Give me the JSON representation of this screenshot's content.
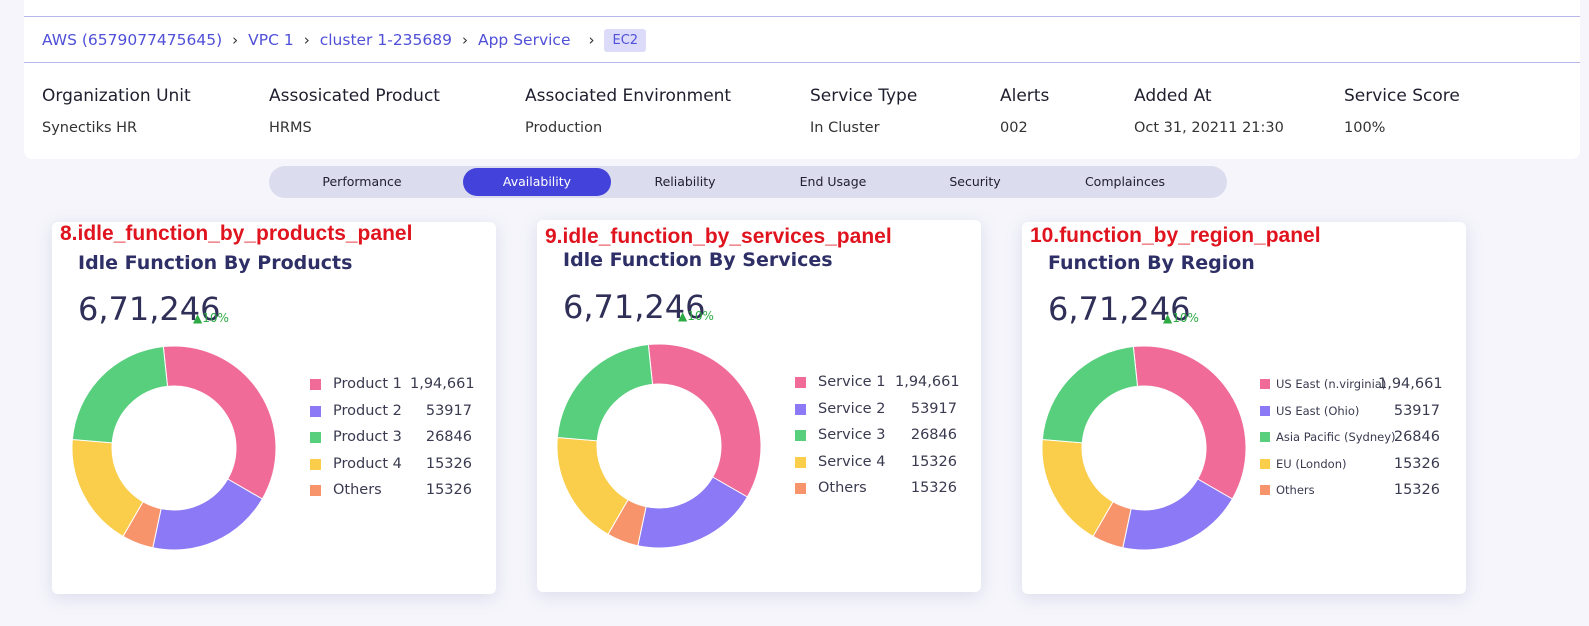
{
  "breadcrumb": {
    "items": [
      "AWS (6579077475645)",
      "VPC 1",
      "cluster 1-235689",
      "App Service"
    ],
    "current": "EC2"
  },
  "info": [
    {
      "label": "Organization Unit",
      "value": "Synectiks HR"
    },
    {
      "label": "Assosicated Product",
      "value": "HRMS"
    },
    {
      "label": "Associated Environment",
      "value": "Production"
    },
    {
      "label": "Service Type",
      "value": "In Cluster"
    },
    {
      "label": "Alerts",
      "value": "002"
    },
    {
      "label": "Added At",
      "value": "Oct 31, 20211 21:30"
    },
    {
      "label": "Service Score",
      "value": "100%"
    }
  ],
  "tabs": [
    "Performance",
    "Availability",
    "Reliability",
    "End Usage",
    "Security",
    "Complainces"
  ],
  "active_tab": "Availability",
  "colors": {
    "accent": "#4343dc",
    "pink": "#f06b98",
    "purple": "#8b79f5",
    "orange": "#f7946b",
    "yellow": "#facd4b",
    "green": "#57cf7c",
    "annotation": "#e0141e",
    "up": "#2eaa44"
  },
  "panels": [
    {
      "tag": "8.idle_function_by_products_panel",
      "title": "Idle Function By Products",
      "total": "6,71,246",
      "change": "10%",
      "legend": [
        {
          "label": "Product 1",
          "value": "1,94,661"
        },
        {
          "label": "Product 2",
          "value": "53917"
        },
        {
          "label": "Product 3",
          "value": "26846"
        },
        {
          "label": "Product 4",
          "value": "15326"
        },
        {
          "label": "Others",
          "value": "15326"
        }
      ]
    },
    {
      "tag": "9.idle_function_by_services_panel",
      "title": "Idle Function By Services",
      "total": "6,71,246",
      "change": "10%",
      "legend": [
        {
          "label": "Service 1",
          "value": "1,94,661"
        },
        {
          "label": "Service 2",
          "value": "53917"
        },
        {
          "label": "Service 3",
          "value": "26846"
        },
        {
          "label": "Service 4",
          "value": "15326"
        },
        {
          "label": "Others",
          "value": "15326"
        }
      ]
    },
    {
      "tag": "10.function_by_region_panel",
      "title": "Function By Region",
      "total": "6,71,246",
      "change": "10%",
      "legend": [
        {
          "label": "US East (n.virginia)",
          "value": "1,94,661"
        },
        {
          "label": "US East (Ohio)",
          "value": "53917"
        },
        {
          "label": "Asia Pacific (Sydney)",
          "value": "26846"
        },
        {
          "label": "EU (London)",
          "value": "15326"
        },
        {
          "label": "Others",
          "value": "15326"
        }
      ]
    }
  ],
  "chart_data": [
    {
      "type": "pie",
      "categories": [
        "Product 1",
        "Product 2",
        "Others",
        "Product 4",
        "Product 3"
      ],
      "values": [
        35,
        20,
        5,
        18,
        22
      ],
      "colors": [
        "#f06b98",
        "#8b79f5",
        "#f7946b",
        "#facd4b",
        "#57cf7c"
      ]
    },
    {
      "type": "pie",
      "categories": [
        "Service 1",
        "Service 2",
        "Others",
        "Service 4",
        "Service 3"
      ],
      "values": [
        35,
        20,
        5,
        18,
        22
      ],
      "colors": [
        "#f06b98",
        "#8b79f5",
        "#f7946b",
        "#facd4b",
        "#57cf7c"
      ]
    },
    {
      "type": "pie",
      "categories": [
        "US East (n.virginia)",
        "US East (Ohio)",
        "Others",
        "EU (London)",
        "Asia Pacific (Sydney)"
      ],
      "values": [
        35,
        20,
        5,
        18,
        22
      ],
      "colors": [
        "#f06b98",
        "#8b79f5",
        "#f7946b",
        "#facd4b",
        "#57cf7c"
      ]
    }
  ]
}
